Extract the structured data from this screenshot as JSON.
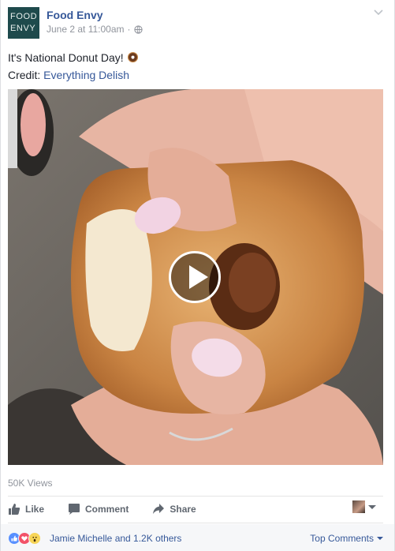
{
  "post": {
    "avatar_lines": [
      "FOOD",
      "ENVY"
    ],
    "page_name": "Food Envy",
    "timestamp": "June 2 at 11:00am",
    "separator": "·",
    "privacy_icon": "globe-icon",
    "options_icon": "chevron-down-icon",
    "text_line1": "It's National Donut Day!",
    "emoji_icon": "donut-emoji",
    "credit_prefix": "Credit:",
    "credit_link": "Everything Delish"
  },
  "video": {
    "play_icon": "play-icon",
    "views": "50K Views"
  },
  "actions": {
    "like": "Like",
    "comment": "Comment",
    "share": "Share"
  },
  "reactions": {
    "icons": [
      "like-reaction",
      "love-reaction",
      "wow-reaction"
    ],
    "summary": "Jamie Michelle and 1.2K others",
    "sort_label": "Top Comments"
  },
  "colors": {
    "link": "#365899",
    "meta": "#90949c",
    "avatar_bg": "#1e4a4c"
  }
}
